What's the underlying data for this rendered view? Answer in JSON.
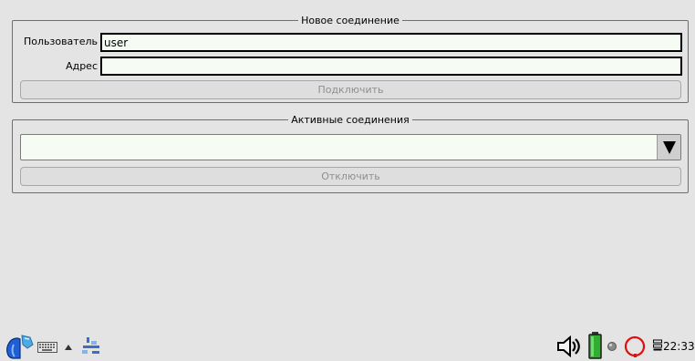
{
  "new_connection": {
    "title": "Новое соединение",
    "user_label": "Пользователь",
    "user_value": "user",
    "address_label": "Адрес",
    "address_value": "",
    "connect_label": "Подключить"
  },
  "active_connections": {
    "title": "Активные соединения",
    "selected": "",
    "disconnect_label": "Отключить"
  },
  "taskbar": {
    "clock": "22:33",
    "left_icons": [
      "start-menu-icon",
      "keyboard-icon",
      "arrow-up-icon",
      "network-icon"
    ],
    "right_icons": [
      "speaker-icon",
      "battery-icon",
      "status-dot-icon",
      "power-icon",
      "menu-lines-icon"
    ]
  }
}
